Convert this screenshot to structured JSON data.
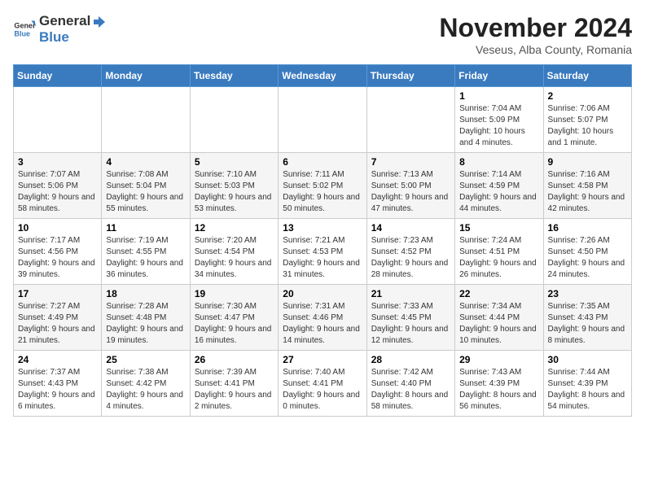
{
  "header": {
    "logo_general": "General",
    "logo_blue": "Blue",
    "month_title": "November 2024",
    "location": "Veseus, Alba County, Romania"
  },
  "weekdays": [
    "Sunday",
    "Monday",
    "Tuesday",
    "Wednesday",
    "Thursday",
    "Friday",
    "Saturday"
  ],
  "weeks": [
    [
      {
        "day": "",
        "info": ""
      },
      {
        "day": "",
        "info": ""
      },
      {
        "day": "",
        "info": ""
      },
      {
        "day": "",
        "info": ""
      },
      {
        "day": "",
        "info": ""
      },
      {
        "day": "1",
        "info": "Sunrise: 7:04 AM\nSunset: 5:09 PM\nDaylight: 10 hours and 4 minutes."
      },
      {
        "day": "2",
        "info": "Sunrise: 7:06 AM\nSunset: 5:07 PM\nDaylight: 10 hours and 1 minute."
      }
    ],
    [
      {
        "day": "3",
        "info": "Sunrise: 7:07 AM\nSunset: 5:06 PM\nDaylight: 9 hours and 58 minutes."
      },
      {
        "day": "4",
        "info": "Sunrise: 7:08 AM\nSunset: 5:04 PM\nDaylight: 9 hours and 55 minutes."
      },
      {
        "day": "5",
        "info": "Sunrise: 7:10 AM\nSunset: 5:03 PM\nDaylight: 9 hours and 53 minutes."
      },
      {
        "day": "6",
        "info": "Sunrise: 7:11 AM\nSunset: 5:02 PM\nDaylight: 9 hours and 50 minutes."
      },
      {
        "day": "7",
        "info": "Sunrise: 7:13 AM\nSunset: 5:00 PM\nDaylight: 9 hours and 47 minutes."
      },
      {
        "day": "8",
        "info": "Sunrise: 7:14 AM\nSunset: 4:59 PM\nDaylight: 9 hours and 44 minutes."
      },
      {
        "day": "9",
        "info": "Sunrise: 7:16 AM\nSunset: 4:58 PM\nDaylight: 9 hours and 42 minutes."
      }
    ],
    [
      {
        "day": "10",
        "info": "Sunrise: 7:17 AM\nSunset: 4:56 PM\nDaylight: 9 hours and 39 minutes."
      },
      {
        "day": "11",
        "info": "Sunrise: 7:19 AM\nSunset: 4:55 PM\nDaylight: 9 hours and 36 minutes."
      },
      {
        "day": "12",
        "info": "Sunrise: 7:20 AM\nSunset: 4:54 PM\nDaylight: 9 hours and 34 minutes."
      },
      {
        "day": "13",
        "info": "Sunrise: 7:21 AM\nSunset: 4:53 PM\nDaylight: 9 hours and 31 minutes."
      },
      {
        "day": "14",
        "info": "Sunrise: 7:23 AM\nSunset: 4:52 PM\nDaylight: 9 hours and 28 minutes."
      },
      {
        "day": "15",
        "info": "Sunrise: 7:24 AM\nSunset: 4:51 PM\nDaylight: 9 hours and 26 minutes."
      },
      {
        "day": "16",
        "info": "Sunrise: 7:26 AM\nSunset: 4:50 PM\nDaylight: 9 hours and 24 minutes."
      }
    ],
    [
      {
        "day": "17",
        "info": "Sunrise: 7:27 AM\nSunset: 4:49 PM\nDaylight: 9 hours and 21 minutes."
      },
      {
        "day": "18",
        "info": "Sunrise: 7:28 AM\nSunset: 4:48 PM\nDaylight: 9 hours and 19 minutes."
      },
      {
        "day": "19",
        "info": "Sunrise: 7:30 AM\nSunset: 4:47 PM\nDaylight: 9 hours and 16 minutes."
      },
      {
        "day": "20",
        "info": "Sunrise: 7:31 AM\nSunset: 4:46 PM\nDaylight: 9 hours and 14 minutes."
      },
      {
        "day": "21",
        "info": "Sunrise: 7:33 AM\nSunset: 4:45 PM\nDaylight: 9 hours and 12 minutes."
      },
      {
        "day": "22",
        "info": "Sunrise: 7:34 AM\nSunset: 4:44 PM\nDaylight: 9 hours and 10 minutes."
      },
      {
        "day": "23",
        "info": "Sunrise: 7:35 AM\nSunset: 4:43 PM\nDaylight: 9 hours and 8 minutes."
      }
    ],
    [
      {
        "day": "24",
        "info": "Sunrise: 7:37 AM\nSunset: 4:43 PM\nDaylight: 9 hours and 6 minutes."
      },
      {
        "day": "25",
        "info": "Sunrise: 7:38 AM\nSunset: 4:42 PM\nDaylight: 9 hours and 4 minutes."
      },
      {
        "day": "26",
        "info": "Sunrise: 7:39 AM\nSunset: 4:41 PM\nDaylight: 9 hours and 2 minutes."
      },
      {
        "day": "27",
        "info": "Sunrise: 7:40 AM\nSunset: 4:41 PM\nDaylight: 9 hours and 0 minutes."
      },
      {
        "day": "28",
        "info": "Sunrise: 7:42 AM\nSunset: 4:40 PM\nDaylight: 8 hours and 58 minutes."
      },
      {
        "day": "29",
        "info": "Sunrise: 7:43 AM\nSunset: 4:39 PM\nDaylight: 8 hours and 56 minutes."
      },
      {
        "day": "30",
        "info": "Sunrise: 7:44 AM\nSunset: 4:39 PM\nDaylight: 8 hours and 54 minutes."
      }
    ]
  ]
}
